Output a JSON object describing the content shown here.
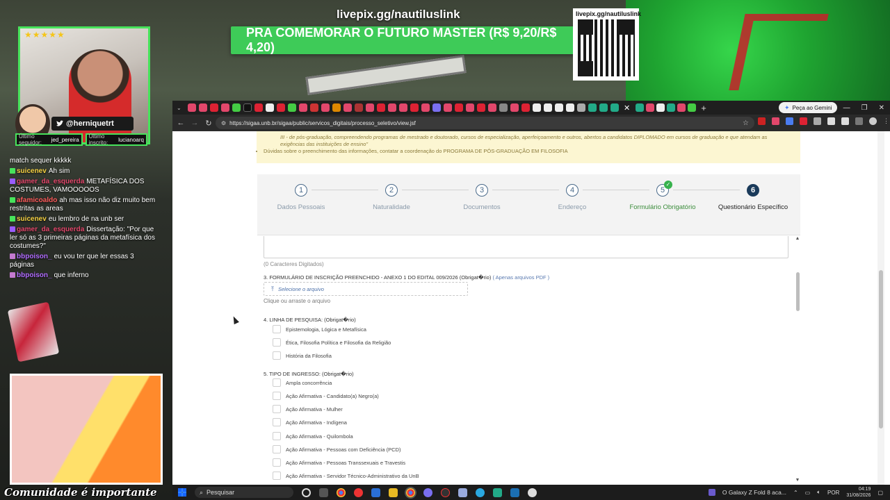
{
  "overlay": {
    "url": "livepix.gg/nautiluslink",
    "promo": "PRA COMEMORAR O FUTURO MASTER (R$ 9,20/R$ 4,20)",
    "qr_label": "livepix.gg/nautiluslink",
    "stars": "★★★★★",
    "handle": "@herniquetrt",
    "last_follower_label": "Último seguidor:",
    "last_follower": "jed_pereira",
    "last_sub_label": "Último inscrito:",
    "last_sub": "lucianoarq",
    "caption": "Comunidade é importante"
  },
  "chat": [
    {
      "user": "",
      "text": "match sequer kkkkk",
      "color": "#ffffff"
    },
    {
      "user": "suicenev",
      "text": "Ah sim",
      "color": "#f5d142"
    },
    {
      "user": "gamer_da_esquerda",
      "text": "METAFÍSICA DOS COSTUMES, VAMOOOOOS",
      "color": "#e2476b"
    },
    {
      "user": "afamicoaldo",
      "text": "ah mas isso não diz muito bem restritas as areas",
      "color": "#ff5d5d"
    },
    {
      "user": "suicenev",
      "text": "eu lembro de na unb ser",
      "color": "#f5d142"
    },
    {
      "user": "gamer_da_esquerda",
      "text": "Dissertação: \"Por que ler só as 3 primeiras páginas da metafísica dos costumes?\"",
      "color": "#e2476b"
    },
    {
      "user": "bbpoison_",
      "text": "eu vou ter que ler essas 3 páginas",
      "color": "#b06bff"
    },
    {
      "user": "bbpoison_",
      "text": "que inferno",
      "color": "#b06bff"
    }
  ],
  "browser": {
    "gemini_button": "Peça ao Gemini",
    "url": "https://sigaa.unb.br/sigaa/public/servicos_digitais/processo_seletivo/view.jsf"
  },
  "notice": {
    "line1": "III - de pós-graduação, compreendendo programas de mestrado e doutorado, cursos de especialização, aperfeiçoamento e outros, abertos a candidatos DIPLOMADO em cursos de graduação e que atendam as",
    "line2": "exigências das instituições de ensino\"",
    "bullet": "Dúvidas sobre o preenchimento das informações, contatar a coordenação do PROGRAMA DE PÓS-GRADUAÇÃO EM FILOSOFIA"
  },
  "steps": [
    {
      "num": "1",
      "label": "Dados Pessoais"
    },
    {
      "num": "2",
      "label": "Naturalidade"
    },
    {
      "num": "3",
      "label": "Documentos"
    },
    {
      "num": "4",
      "label": "Endereço"
    },
    {
      "num": "5",
      "label": "Formulário Obrigatório"
    },
    {
      "num": "6",
      "label": "Questionário Específico"
    }
  ],
  "form": {
    "char_count": "(0 Caracteres Digitados)",
    "q3_label": "3. FORMULÁRIO DE INSCRIÇÃO PREENCHIDO - ANEXO 1 DO EDITAL 009/2026 (Obrigat�rio)",
    "q3_hint": "( Apenas arquivos PDF )",
    "file_placeholder": "Selecione o arquivo",
    "file_hint": "Clique ou arraste o arquivo",
    "q4_label": "4. LINHA DE PESQUISA: (Obrigat�rio)",
    "q4_options": [
      "Epistemologia, Lógica e Metafísica",
      "Ética, Filosofia Política e Filosofia da Religião",
      "História da Filosofia"
    ],
    "q5_label": "5. TIPO DE INGRESSO: (Obrigat�rio)",
    "q5_options": [
      "Ampla concorrência",
      "Ação Afirmativa - Candidato(a) Negro(a)",
      "Ação Afirmativa - Mulher",
      "Ação Afirmativa - Indígena",
      "Ação Afirmativa - Quilombola",
      "Ação Afirmativa - Pessoas com Deficiência (PCD)",
      "Ação Afirmativa - Pessoas Transsexuais e Travestis",
      "Ação Afirmativa - Servidor Técnico-Administrativo da UnB"
    ]
  },
  "taskbar": {
    "search_placeholder": "Pesquisar",
    "news": "O Galaxy Z Fold 8 aca...",
    "lang": "POR",
    "time": "04:19",
    "date": "31/08/2026"
  },
  "colors": {
    "promo_green": "#3ecb58",
    "step_active": "#1a3a5a",
    "step_done_label": "#3c8d3c",
    "notice_bg": "#fcf6d2",
    "scroll_top_btn": "#2a5686"
  }
}
